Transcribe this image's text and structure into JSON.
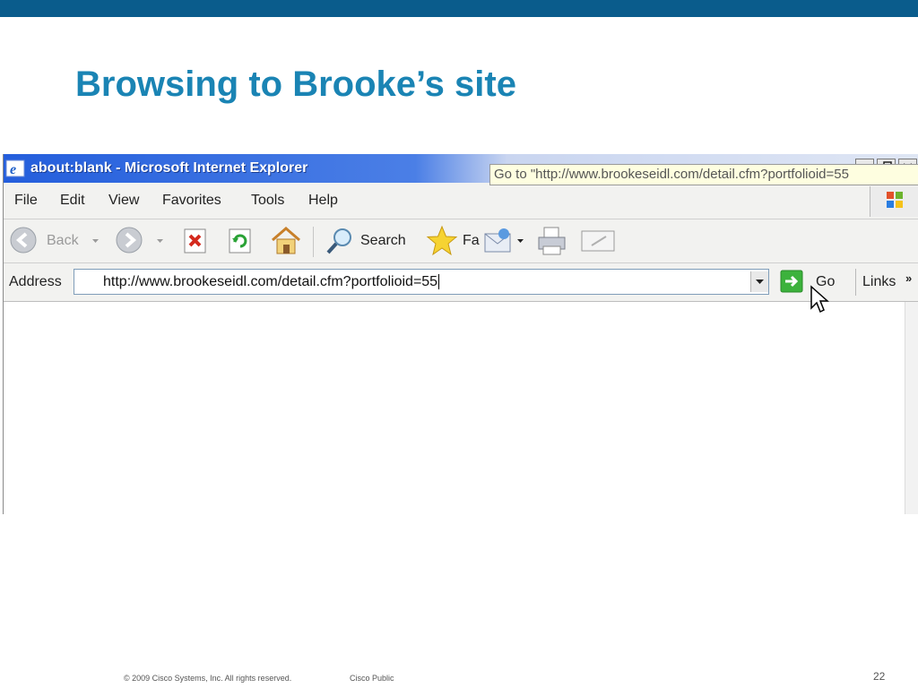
{
  "slide": {
    "title": "Browsing to Brooke’s site",
    "footer_copyright": "© 2009 Cisco Systems, Inc. All rights reserved.",
    "footer_classification": "Cisco Public",
    "page_number": "22",
    "band_color": "#0a5c8c",
    "title_color": "#1a84b4"
  },
  "browser": {
    "window_title": "about:blank - Microsoft Internet Explorer",
    "menu": [
      "File",
      "Edit",
      "View",
      "Favorites",
      "Tools",
      "Help"
    ],
    "toolbar": {
      "back_label": "Back",
      "search_label": "Search",
      "favorites_label": "Fa",
      "icons": [
        "back-icon",
        "forward-icon",
        "stop-icon",
        "refresh-icon",
        "home-icon",
        "search-icon",
        "favorites-star-icon",
        "mail-icon",
        "print-icon",
        "edit-icon"
      ]
    },
    "address": {
      "label": "Address",
      "url": "http://www.brookeseidl.com/detail.cfm?portfolioid=55",
      "go_label": "Go",
      "links_label": "Links",
      "links_chevron": "»"
    },
    "tooltip": "Go to \"http://www.brookeseidl.com/detail.cfm?portfolioid=55"
  }
}
